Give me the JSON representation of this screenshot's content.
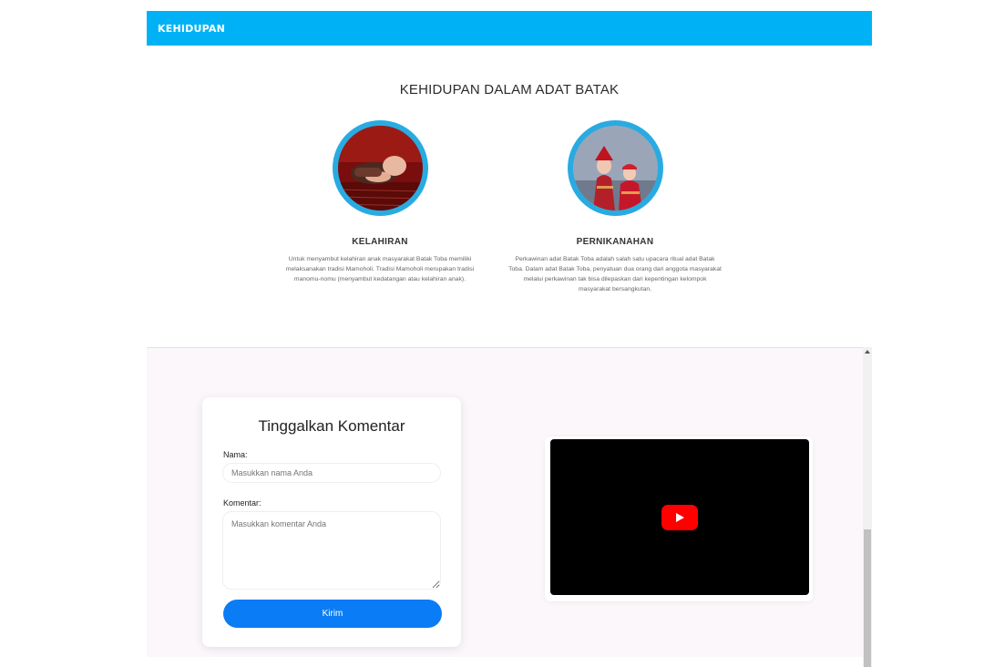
{
  "navbar": {
    "brand": "KEHIDUPAN",
    "color": "#00b2f5"
  },
  "section": {
    "title": "KEHIDUPAN DALAM ADAT BATAK",
    "cards": [
      {
        "title": "KELAHIRAN",
        "description": "Untuk menyambut kelahiran anak masyarakat Batak Toba memiliki melaksanakan tradisi Mamoholi. Tradisi Mamoholi merupakan tradisi manomu-nomu (menyambut kedatangan atau kelahiran anak).",
        "image_icon": "newborn-photo"
      },
      {
        "title": "PERNIKANAHAN",
        "description": "Perkawinan adat Batak Toba adalah salah satu upacara ritual adat Batak Toba. Dalam adat Batak Toba, penyatuan dua orang dari anggota masyarakat melalui perkawinan tak bisa dilepaskan dari kepentingan kelompok masyarakat bersangkutan.",
        "image_icon": "wedding-couple-photo"
      }
    ]
  },
  "comment_form": {
    "title": "Tinggalkan Komentar",
    "name_label": "Nama:",
    "name_placeholder": "Masukkan nama Anda",
    "comment_label": "Komentar:",
    "comment_placeholder": "Masukkan komentar Anda",
    "submit_label": "Kirim",
    "submit_color": "#0a7cf5"
  },
  "video": {
    "play_icon": "youtube-play-icon"
  }
}
